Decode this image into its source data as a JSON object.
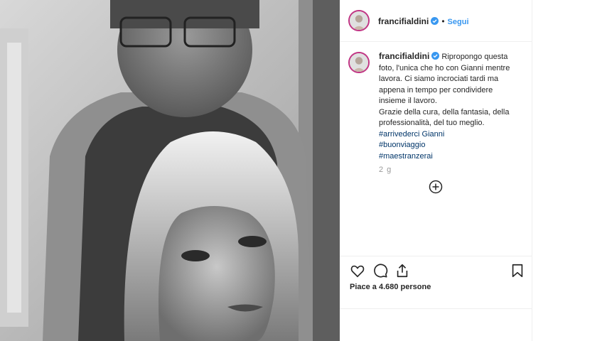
{
  "post": {
    "username": "francifialdini",
    "follow_label": "Segui",
    "dot": "•",
    "caption_lines": [
      "Ripropongo questa",
      "foto, l'unica che ho con Gianni mentre",
      "lavora. Ci siamo incrociati tardi ma",
      "appena in tempo per condividere",
      "insieme il lavoro.",
      "Grazie della cura, della fantasia, della",
      "professionalità, del tuo meglio."
    ],
    "hashtags": [
      "#arrivederci Gianni",
      "#buonviaggio",
      "#maestranzerai"
    ],
    "time": "2 g",
    "likes": "Piace a 4.680 persone"
  },
  "icons": {
    "verified": "verified-badge-icon",
    "plus": "plus-circle-icon",
    "like": "heart-icon",
    "comment": "comment-icon",
    "share": "share-icon",
    "save": "bookmark-icon"
  },
  "colors": {
    "link_blue": "#3897f0",
    "hashtag": "#003569",
    "avatar_ring": "#c13584",
    "text": "#262626"
  }
}
